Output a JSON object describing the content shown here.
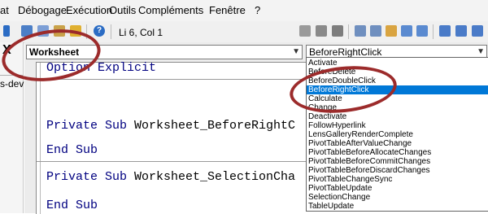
{
  "menu": {
    "items": [
      "at",
      "Débogage",
      "Exécution",
      "Outils",
      "Compléments",
      "Fenêtre",
      "?"
    ]
  },
  "toolbar": {
    "position": "Li 6, Col 1",
    "colors": {
      "icon_blue": "#2b6cc4",
      "icon_yellow": "#e0b030",
      "icon_gray": "#7d7d7d"
    }
  },
  "left_panel": {
    "close_glyph": "X",
    "project_label": "s-dev"
  },
  "code_window": {
    "object_combo": "Worksheet",
    "procedure_combo": "BeforeRightClick",
    "lines": {
      "line1": {
        "kw": "Option Explicit",
        "rest": ""
      },
      "line2": {
        "kw": "Private Sub ",
        "rest": "Worksheet_BeforeRightC"
      },
      "line3": {
        "kw": "End Sub",
        "rest": ""
      },
      "line4": {
        "kw": "Private Sub ",
        "rest": "Worksheet_SelectionCha"
      },
      "line5": {
        "kw": "End Sub",
        "rest": ""
      }
    }
  },
  "dropdown": {
    "items": [
      "Activate",
      "BeforeDelete",
      "BeforeDoubleClick",
      "BeforeRightClick",
      "Calculate",
      "Change",
      "Deactivate",
      "FollowHyperlink",
      "LensGalleryRenderComplete",
      "PivotTableAfterValueChange",
      "PivotTableBeforeAllocateChanges",
      "PivotTableBeforeCommitChanges",
      "PivotTableBeforeDiscardChanges",
      "PivotTableChangeSync",
      "PivotTableUpdate",
      "SelectionChange",
      "TableUpdate"
    ],
    "selected_index": 3,
    "colors": {
      "selection": "#0078d7"
    }
  },
  "annotation": {
    "ring_color": "#9c2b2b"
  }
}
